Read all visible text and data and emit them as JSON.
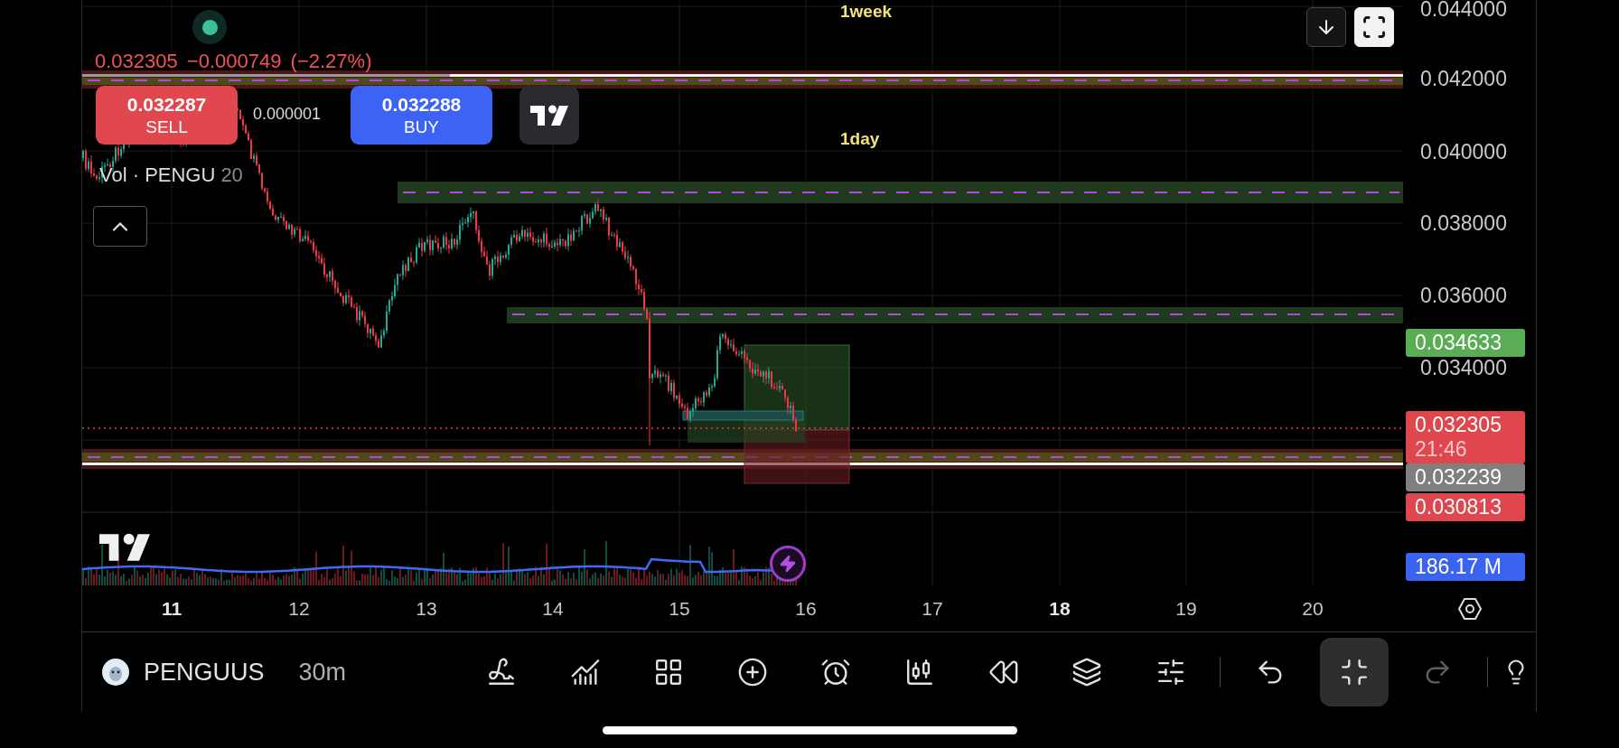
{
  "header": {
    "quote": "0.032305 −0.000749 (−2.27%)"
  },
  "trade": {
    "sell": {
      "price": "0.032287",
      "label": "SELL"
    },
    "spread": "0.000001",
    "buy": {
      "price": "0.032288",
      "label": "BUY"
    }
  },
  "timeframe_labels": [
    "1week",
    "1day"
  ],
  "volume_legend": {
    "label": "Vol · PENGU",
    "length": "20"
  },
  "price_axis": [
    "0.044000",
    "0.042000",
    "0.040000",
    "0.038000",
    "0.036000",
    "0.034000"
  ],
  "price_tags": [
    {
      "value": "0.034633",
      "color": "#5aac55"
    },
    {
      "value": "0.032305",
      "countdown": "21:46",
      "color": "#e0464e"
    },
    {
      "value": "0.032239",
      "color": "#7f7f7f"
    },
    {
      "value": "0.030813",
      "color": "#e0464e"
    },
    {
      "value": "186.17 M",
      "color": "#3a63f0"
    }
  ],
  "date_axis": [
    {
      "label": "11",
      "bold": true
    },
    {
      "label": "12",
      "bold": false
    },
    {
      "label": "13",
      "bold": false
    },
    {
      "label": "14",
      "bold": false
    },
    {
      "label": "15",
      "bold": false
    },
    {
      "label": "16",
      "bold": false
    },
    {
      "label": "17",
      "bold": false
    },
    {
      "label": "18",
      "bold": true
    },
    {
      "label": "19",
      "bold": false
    },
    {
      "label": "20",
      "bold": false
    }
  ],
  "symbol": {
    "name": "PENGUUS",
    "interval": "30m"
  },
  "toolbar": [
    {
      "selected": false,
      "disabled": false
    },
    {
      "selected": false,
      "disabled": false
    },
    {
      "selected": false,
      "disabled": false
    },
    {
      "selected": false,
      "disabled": false
    },
    {
      "selected": false,
      "disabled": false
    },
    {
      "selected": false,
      "disabled": false
    },
    {
      "selected": false,
      "disabled": false
    },
    {
      "selected": false,
      "disabled": false
    },
    {
      "selected": false,
      "disabled": false
    },
    {
      "selected": false,
      "disabled": false
    },
    {
      "selected": true,
      "disabled": false
    },
    {
      "selected": false,
      "disabled": true
    },
    {
      "selected": false,
      "disabled": false
    }
  ]
}
